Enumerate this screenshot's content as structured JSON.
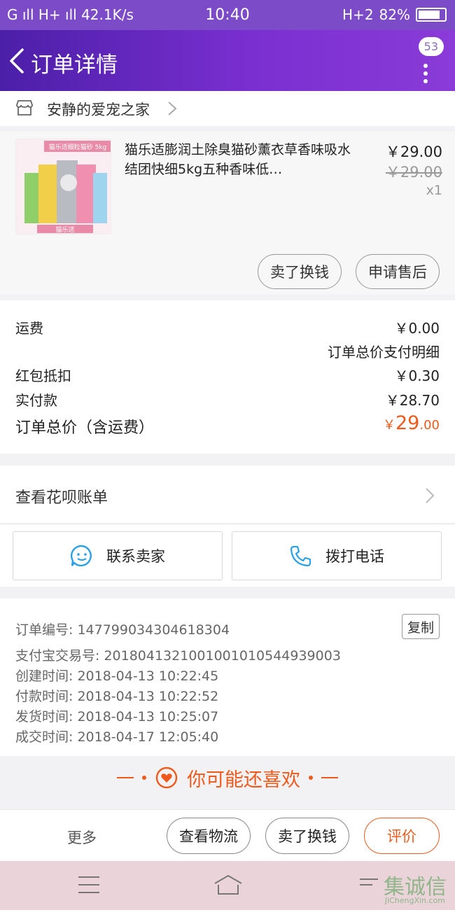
{
  "status_bar": {
    "left": "G ıll H+ ıll 42.1K/s",
    "time": "10:40",
    "right_signal": "H+2",
    "battery": "82%"
  },
  "header": {
    "title": "订单详情",
    "badge": "53"
  },
  "shop": {
    "name": "安静的爱宠之家"
  },
  "product": {
    "title": "猫乐适膨润土除臭猫砂薰衣草香味吸水结团快细5kg五种香味低…",
    "thumb_caption": "猫乐适细粒猫砂 5kg",
    "thumb_brand": "猫乐适",
    "price": "￥29.00",
    "original_price": "￥29.00",
    "quantity": "x1",
    "buttons": [
      "卖了换钱",
      "申请售后"
    ]
  },
  "fees": {
    "shipping_label": "运费",
    "shipping_value": "￥0.00",
    "detail_link": "订单总价支付明细",
    "redpacket_label": "红包抵扣",
    "redpacket_value": "￥0.30",
    "paid_label": "实付款",
    "paid_value": "￥28.70",
    "total_label": "订单总价（含运费）",
    "total_currency": "￥",
    "total_int": "29",
    "total_dec": ".00"
  },
  "huabei": {
    "label": "查看花呗账单"
  },
  "contact": {
    "seller": "联系卖家",
    "call": "拨打电话"
  },
  "order_info": {
    "order_no": "订单编号: 147799034304618304",
    "copy": "复制",
    "alipay_no": "支付宝交易号: 2018041321001001010544939003",
    "created": "创建时间: 2018-04-13 10:22:45",
    "paid": "付款时间: 2018-04-13 10:22:52",
    "shipped": "发货时间: 2018-04-13 10:25:07",
    "completed": "成交时间: 2018-04-17 12:05:40"
  },
  "recommend": {
    "title": "你可能还喜欢"
  },
  "action_bar": {
    "more": "更多",
    "logistics": "查看物流",
    "sell": "卖了换钱",
    "review": "评价"
  },
  "watermark": {
    "text": "集诚信",
    "sub": "JiChengXin.com"
  },
  "colors": {
    "accent": "#ee5a1c",
    "header_start": "#4b1fa8",
    "header_end": "#8a3bd8",
    "link_blue": "#2aa0e8"
  }
}
